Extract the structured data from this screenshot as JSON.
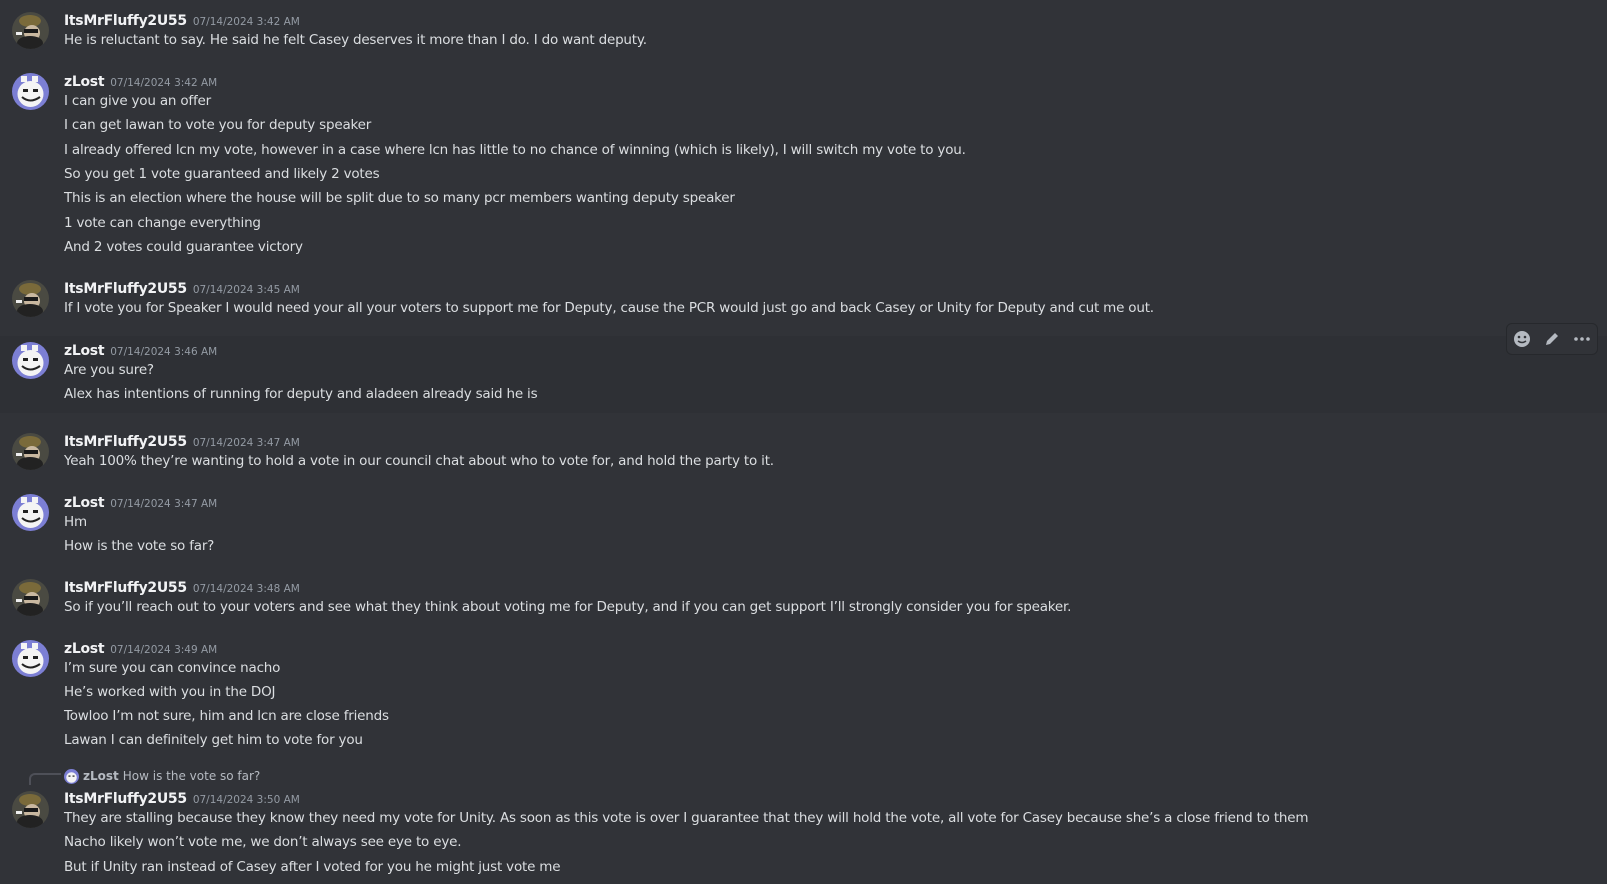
{
  "colors": {
    "background": "#313338",
    "username": "#f2f3f5",
    "timestamp": "#949ba4",
    "message_text": "#dbdee1"
  },
  "messages": [
    {
      "author": "ItsMrFluffy2U55",
      "timestamp": "07/14/2024 3:42 AM",
      "lines": [
        "He is reluctant to say. He said he felt Casey deserves it more than I do. I do want deputy."
      ]
    },
    {
      "author": "zLost",
      "timestamp": "07/14/2024 3:42 AM",
      "lines": [
        "I can give you an offer",
        "I can get lawan to vote you for deputy speaker",
        "I already offered lcn my vote, however in a case where lcn has little to no chance of winning (which is likely), I will switch my vote to you.",
        "So you get 1 vote guaranteed and likely 2 votes",
        "This is an election where the house will be split due to so many pcr members wanting deputy speaker",
        "1 vote can change everything",
        "And 2 votes could guarantee victory"
      ]
    },
    {
      "author": "ItsMrFluffy2U55",
      "timestamp": "07/14/2024 3:45 AM",
      "lines": [
        "If I vote you for Speaker I would need your all your voters to support me for Deputy, cause the PCR would just go and back Casey or Unity for Deputy and cut me out."
      ]
    },
    {
      "author": "zLost",
      "timestamp": "07/14/2024 3:46 AM",
      "lines": [
        "Are you sure?",
        "Alex has intentions of running for deputy and aladeen already said he is"
      ]
    },
    {
      "author": "ItsMrFluffy2U55",
      "timestamp": "07/14/2024 3:47 AM",
      "lines": [
        "Yeah 100% they’re wanting to hold a vote in our council chat about who to vote for, and hold the party to it."
      ]
    },
    {
      "author": "zLost",
      "timestamp": "07/14/2024 3:47 AM",
      "lines": [
        "Hm",
        "How is the vote so far?"
      ]
    },
    {
      "author": "ItsMrFluffy2U55",
      "timestamp": "07/14/2024 3:48 AM",
      "lines": [
        "So if you’ll reach out to your voters and see what they think about voting me for Deputy, and if you can get support I’ll strongly consider you for speaker."
      ]
    },
    {
      "author": "zLost",
      "timestamp": "07/14/2024 3:49 AM",
      "lines": [
        "I’m sure you can convince nacho",
        "He’s worked with you in the DOJ",
        "Towloo I’m not sure, him and lcn are close friends",
        "Lawan I can definitely get him to vote for you"
      ]
    },
    {
      "author": "ItsMrFluffy2U55",
      "timestamp": "07/14/2024 3:50 AM",
      "reply": {
        "author": "zLost",
        "text": "How is the vote so far?"
      },
      "lines": [
        "They are stalling because they know they need my vote for Unity. As soon as this vote is over I guarantee that they will hold the vote, all vote for Casey because she’s a close friend to them",
        "Nacho likely won’t vote me, we don’t always see eye to eye.",
        "But if Unity ran instead of Casey after I voted for you he might just vote me"
      ]
    }
  ],
  "toolbar": {
    "buttons": [
      "add-reaction-icon",
      "edit-icon",
      "more-options-icon"
    ]
  }
}
